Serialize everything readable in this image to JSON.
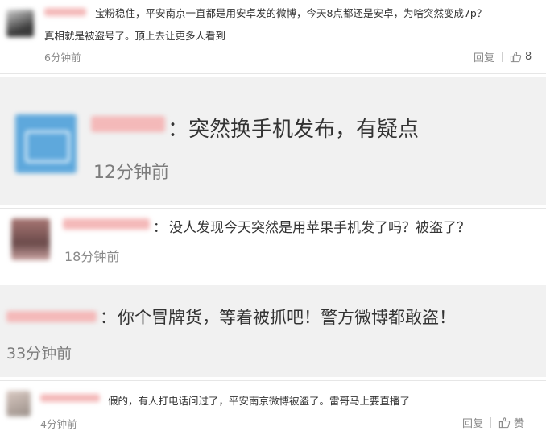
{
  "comments": [
    {
      "text_line1": "宝粉稳住，平安南京一直都是用安卓发的微博，今天8点都还是安卓，为啥突然变成7p？",
      "text_line2": "真相就是被盗号了。顶上去让更多人看到",
      "time": "6分钟前",
      "reply_label": "回复",
      "like_count": "8"
    },
    {
      "colon": "：",
      "text": "突然换手机发布，有疑点",
      "time": "12分钟前"
    },
    {
      "colon": "：",
      "text": "没人发现今天突然是用苹果手机发了吗？被盗了？",
      "time": "18分钟前"
    },
    {
      "colon": "：",
      "text": "你个冒牌货，等着被抓吧！警方微博都敢盗！",
      "time": "33分钟前"
    },
    {
      "text": "假的，有人打电话问过了，平安南京微博被盗了。雷哥马上要直播了",
      "time": "4分钟前",
      "reply_label": "回复",
      "like_label": "赞"
    }
  ],
  "colors": {
    "panel_gray": "#f1f1f1",
    "name_pink": "#f4b9b9",
    "time_gray": "#8a8a8a"
  },
  "icons": [
    "thumbs-up-icon"
  ]
}
